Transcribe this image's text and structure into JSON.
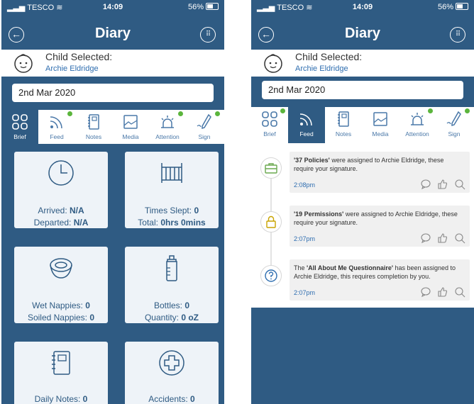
{
  "status": {
    "carrier": "TESCO",
    "time": "14:09",
    "battery": "56%"
  },
  "nav": {
    "title": "Diary"
  },
  "child": {
    "label": "Child Selected:",
    "name": "Archie Eldridge"
  },
  "date": "2nd Mar 2020",
  "tabs": [
    {
      "label": "Brief",
      "icon": "grid-icon"
    },
    {
      "label": "Feed",
      "icon": "feed-icon"
    },
    {
      "label": "Notes",
      "icon": "notes-icon"
    },
    {
      "label": "Media",
      "icon": "media-icon"
    },
    {
      "label": "Attention",
      "icon": "alarm-icon"
    },
    {
      "label": "Sign",
      "icon": "pen-icon"
    }
  ],
  "cards": {
    "arrived": {
      "label": "Arrived:",
      "value": "N/A"
    },
    "departed": {
      "label": "Departed:",
      "value": "N/A"
    },
    "times_slept": {
      "label": "Times Slept:",
      "value": "0"
    },
    "total": {
      "label": "Total:",
      "value": "0hrs 0mins"
    },
    "wet": {
      "label": "Wet Nappies:",
      "value": "0"
    },
    "soiled": {
      "label": "Soiled Nappies:",
      "value": "0"
    },
    "bottles": {
      "label": "Bottles:",
      "value": "0"
    },
    "quantity": {
      "label": "Quantity:",
      "value": "0 oZ"
    },
    "daily_notes": {
      "label": "Daily Notes:",
      "value": "0"
    },
    "accidents": {
      "label": "Accidents:",
      "value": "0"
    }
  },
  "feed": [
    {
      "bold": "'37 Policies'",
      "rest": " were assigned to Archie Eldridge, these require your signature.",
      "time": "2:08pm",
      "icon": "briefcase-icon"
    },
    {
      "bold": "'19 Permissions'",
      "rest": " were assigned to Archie Eldridge, these require your signature.",
      "time": "2:07pm",
      "icon": "lock-icon"
    },
    {
      "pre": "The ",
      "bold": "'All About Me Questionnaire'",
      "rest": " has been assigned to Archie Eldridge, this requires completion by you.",
      "time": "2:07pm",
      "icon": "question-icon"
    }
  ],
  "colors": {
    "primary": "#2f5b83",
    "accent_green": "#5bb53c",
    "link_blue": "#2f6eb0"
  }
}
